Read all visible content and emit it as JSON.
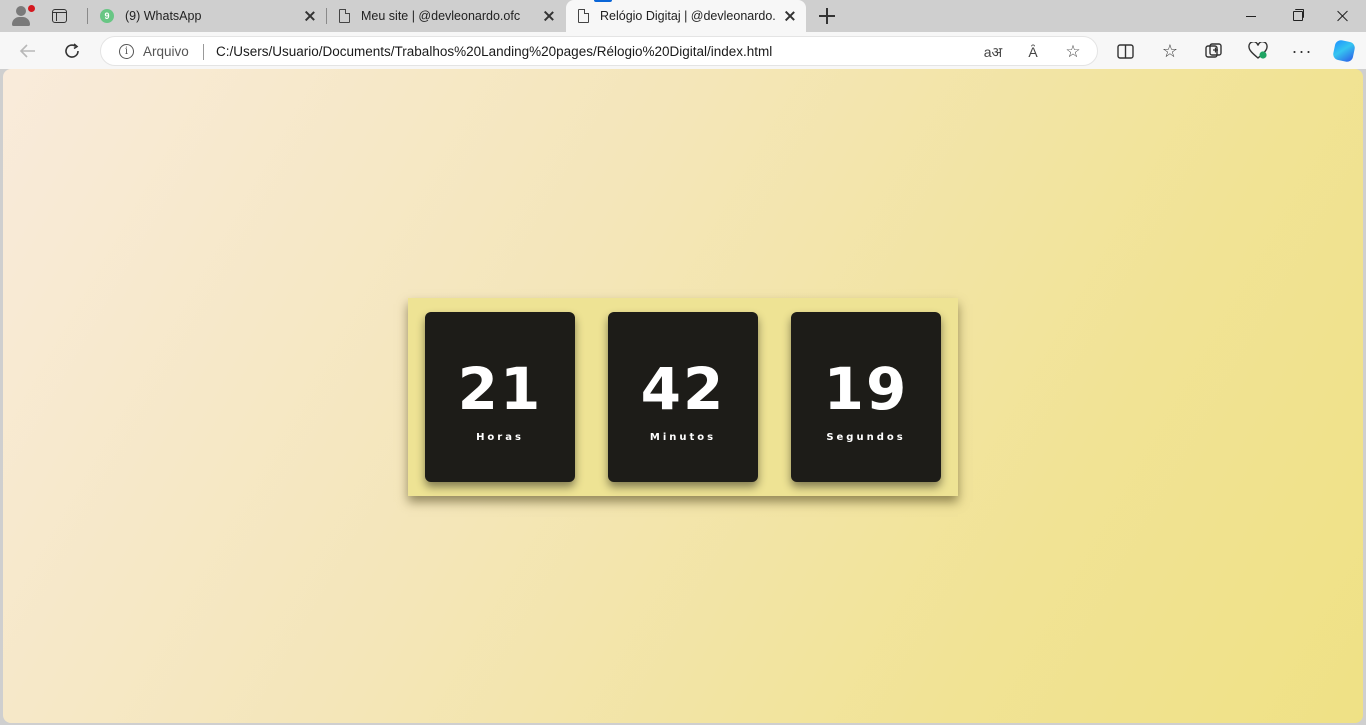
{
  "browser": {
    "tabs": [
      {
        "title": "(9) WhatsApp",
        "badge": "9",
        "active": false
      },
      {
        "title": "Meu site | @devleonardo.ofc",
        "active": false
      },
      {
        "title": "Relógio Digitaj | @devleonardo.o",
        "active": true
      }
    ],
    "address_bar": {
      "scheme_label": "Arquivo",
      "url": "C:/Users/Usuario/Documents/Trabalhos%20Landing%20pages/Rélogio%20Digital/index.html"
    },
    "icons": {
      "read_aloud": "read-aloud-icon",
      "translate": "translate-icon",
      "favorite": "star-icon",
      "split": "split-screen-icon",
      "favorites": "favorites-icon",
      "collections": "collections-icon",
      "health": "browser-essentials-icon",
      "more": "more-icon",
      "copilot": "copilot-icon"
    },
    "accent_color": "#0a66d8"
  },
  "clock": {
    "hours": {
      "value": "21",
      "label": "Horas"
    },
    "minutes": {
      "value": "42",
      "label": "Minutos"
    },
    "seconds": {
      "value": "19",
      "label": "Segundos"
    },
    "card_color": "#1d1c18",
    "frame_color": "#eee394"
  }
}
